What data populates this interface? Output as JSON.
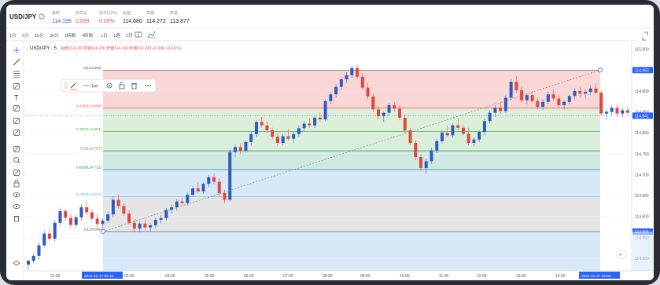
{
  "header": {
    "symbol": "USD/JPY",
    "stats": [
      {
        "label": "最新",
        "value": "114.199",
        "color": "#2962ff"
      },
      {
        "label": "前日比",
        "value": "0.099",
        "color": "#ef5350"
      },
      {
        "label": "前日比(%)",
        "value": "0.09%",
        "color": "#ef5350"
      },
      {
        "label": "始値",
        "value": "114.080",
        "color": "#222222"
      },
      {
        "label": "高値",
        "value": "114.272",
        "color": "#222222"
      },
      {
        "label": "安値",
        "value": "113.877",
        "color": "#222222"
      }
    ]
  },
  "timeframes": [
    "1分",
    "5分",
    "15分",
    "30分",
    "1時間",
    "4時間",
    "1日",
    "1週",
    "1月"
  ],
  "active_timeframe": "5分",
  "legend": {
    "pair": "USD/JPY · 5",
    "ohlc": "始値114.193 高値114.200 安値114.193 終値114.199 +0.006 (+0.01%)"
  },
  "drawing_toolbar": {
    "width_label": "1px"
  },
  "fib": {
    "levels": [
      {
        "ratio": "0",
        "label": "0(114.950)",
        "price": 114.95,
        "color": "#555555"
      },
      {
        "ratio": "0.236",
        "label": "0.236(114.859)",
        "price": 114.859,
        "color": "#ef5350"
      },
      {
        "ratio": "0.382",
        "label": "0.382(114.803)",
        "price": 114.803,
        "color": "#4caf50"
      },
      {
        "ratio": "0.5",
        "label": "0.5(114.757)",
        "price": 114.757,
        "color": "#2e9b3a"
      },
      {
        "ratio": "0.618",
        "label": "0.618(114.712)",
        "price": 114.712,
        "color": "#00897b"
      },
      {
        "ratio": "0.786",
        "label": "0.786(114.647)",
        "price": 114.647,
        "color": "#64b5f6"
      },
      {
        "ratio": "1",
        "label": "1(114.564)",
        "price": 114.564,
        "color": "#555555"
      }
    ]
  },
  "price_axis": {
    "ticks": [
      "115.000",
      "114.950",
      "114.900",
      "114.850",
      "114.800",
      "114.750",
      "114.700",
      "114.650",
      "114.600",
      "114.550",
      "114.500"
    ],
    "current_price": "114.841",
    "fib_top_tag": "114.950",
    "fib_bottom_tag": "114.564"
  },
  "time_axis": {
    "ticks": [
      "01:00",
      "02:15",
      "03:00",
      "04:00",
      "05:00",
      "06:00",
      "07:00",
      "08:00",
      "09:00",
      "10:00",
      "11:00",
      "12:00",
      "13:00",
      "14:00"
    ],
    "start_tag": "2021-11-17 02:15",
    "end_tag": "2021-11-17 15:00",
    "zoom": "1D"
  },
  "chart_data": {
    "type": "candlestick",
    "y_range": [
      114.47,
      115.02
    ],
    "candles": [
      [
        114.485,
        114.497,
        114.472,
        114.494
      ],
      [
        114.494,
        114.512,
        114.488,
        114.506
      ],
      [
        114.506,
        114.538,
        114.498,
        114.531
      ],
      [
        114.531,
        114.567,
        114.526,
        114.559
      ],
      [
        114.559,
        114.574,
        114.541,
        114.547
      ],
      [
        114.547,
        114.592,
        114.54,
        114.585
      ],
      [
        114.585,
        114.621,
        114.578,
        114.613
      ],
      [
        114.613,
        114.618,
        114.59,
        114.597
      ],
      [
        114.597,
        114.608,
        114.572,
        114.58
      ],
      [
        114.58,
        114.604,
        114.574,
        114.598
      ],
      [
        114.598,
        114.63,
        114.59,
        114.622
      ],
      [
        114.622,
        114.638,
        114.603,
        114.61
      ],
      [
        114.61,
        114.618,
        114.589,
        114.595
      ],
      [
        114.595,
        114.606,
        114.573,
        114.582
      ],
      [
        114.582,
        114.596,
        114.565,
        114.59
      ],
      [
        114.59,
        114.612,
        114.584,
        114.605
      ],
      [
        114.605,
        114.648,
        114.598,
        114.64
      ],
      [
        114.64,
        114.652,
        114.618,
        114.625
      ],
      [
        114.625,
        114.631,
        114.601,
        114.607
      ],
      [
        114.607,
        114.614,
        114.58,
        114.585
      ],
      [
        114.585,
        114.594,
        114.562,
        114.571
      ],
      [
        114.571,
        114.589,
        114.562,
        114.583
      ],
      [
        114.583,
        114.592,
        114.568,
        114.574
      ],
      [
        114.574,
        114.584,
        114.563,
        114.579
      ],
      [
        114.579,
        114.598,
        114.572,
        114.592
      ],
      [
        114.592,
        114.603,
        114.583,
        114.596
      ],
      [
        114.596,
        114.62,
        114.59,
        114.616
      ],
      [
        114.616,
        114.629,
        114.606,
        114.622
      ],
      [
        114.622,
        114.642,
        114.614,
        114.636
      ],
      [
        114.636,
        114.644,
        114.626,
        114.632
      ],
      [
        114.632,
        114.658,
        114.627,
        114.652
      ],
      [
        114.652,
        114.672,
        114.647,
        114.667
      ],
      [
        114.667,
        114.682,
        114.655,
        114.66
      ],
      [
        114.66,
        114.682,
        114.655,
        114.678
      ],
      [
        114.678,
        114.7,
        114.67,
        114.694
      ],
      [
        114.694,
        114.702,
        114.676,
        114.683
      ],
      [
        114.683,
        114.69,
        114.648,
        114.656
      ],
      [
        114.656,
        114.664,
        114.632,
        114.64
      ],
      [
        114.64,
        114.76,
        114.636,
        114.754
      ],
      [
        114.754,
        114.772,
        114.742,
        114.766
      ],
      [
        114.766,
        114.775,
        114.75,
        114.757
      ],
      [
        114.757,
        114.782,
        114.752,
        114.778
      ],
      [
        114.778,
        114.802,
        114.77,
        114.797
      ],
      [
        114.797,
        114.83,
        114.79,
        114.826
      ],
      [
        114.826,
        114.838,
        114.812,
        114.818
      ],
      [
        114.818,
        114.826,
        114.8,
        114.806
      ],
      [
        114.806,
        114.812,
        114.785,
        114.791
      ],
      [
        114.791,
        114.8,
        114.768,
        114.776
      ],
      [
        114.776,
        114.798,
        114.77,
        114.792
      ],
      [
        114.792,
        114.81,
        114.782,
        114.786
      ],
      [
        114.786,
        114.802,
        114.775,
        114.797
      ],
      [
        114.797,
        114.818,
        114.79,
        114.811
      ],
      [
        114.811,
        114.828,
        114.803,
        114.822
      ],
      [
        114.822,
        114.835,
        114.812,
        114.818
      ],
      [
        114.818,
        114.84,
        114.812,
        114.836
      ],
      [
        114.836,
        114.85,
        114.826,
        114.832
      ],
      [
        114.832,
        114.88,
        114.828,
        114.876
      ],
      [
        114.876,
        114.898,
        114.869,
        114.892
      ],
      [
        114.892,
        114.916,
        114.884,
        114.91
      ],
      [
        114.91,
        114.933,
        114.902,
        114.928
      ],
      [
        114.928,
        114.945,
        114.919,
        114.938
      ],
      [
        114.938,
        114.96,
        114.93,
        114.955
      ],
      [
        114.955,
        114.962,
        114.928,
        114.934
      ],
      [
        114.934,
        114.942,
        114.902,
        114.908
      ],
      [
        114.908,
        114.92,
        114.88,
        114.887
      ],
      [
        114.887,
        114.894,
        114.85,
        114.856
      ],
      [
        114.856,
        114.865,
        114.832,
        114.84
      ],
      [
        114.84,
        114.852,
        114.826,
        114.848
      ],
      [
        114.848,
        114.872,
        114.842,
        114.866
      ],
      [
        114.866,
        114.874,
        114.85,
        114.858
      ],
      [
        114.858,
        114.866,
        114.83,
        114.836
      ],
      [
        114.836,
        114.844,
        114.8,
        114.806
      ],
      [
        114.806,
        114.812,
        114.77,
        114.776
      ],
      [
        114.776,
        114.782,
        114.735,
        114.742
      ],
      [
        114.742,
        114.75,
        114.708,
        114.716
      ],
      [
        114.716,
        114.738,
        114.702,
        114.732
      ],
      [
        114.732,
        114.764,
        114.726,
        114.758
      ],
      [
        114.758,
        114.786,
        114.752,
        114.78
      ],
      [
        114.78,
        114.806,
        114.774,
        114.8
      ],
      [
        114.8,
        114.816,
        114.79,
        114.794
      ],
      [
        114.794,
        114.822,
        114.788,
        114.818
      ],
      [
        114.818,
        114.834,
        114.805,
        114.812
      ],
      [
        114.812,
        114.82,
        114.794,
        114.798
      ],
      [
        114.798,
        114.812,
        114.77,
        114.776
      ],
      [
        114.776,
        114.79,
        114.768,
        114.784
      ],
      [
        114.784,
        114.806,
        114.778,
        114.802
      ],
      [
        114.802,
        114.834,
        114.796,
        114.828
      ],
      [
        114.828,
        114.854,
        114.822,
        114.848
      ],
      [
        114.848,
        114.866,
        114.838,
        114.86
      ],
      [
        114.86,
        114.874,
        114.846,
        114.852
      ],
      [
        114.852,
        114.89,
        114.848,
        114.884
      ],
      [
        114.884,
        114.93,
        114.878,
        114.922
      ],
      [
        114.922,
        114.936,
        114.896,
        114.902
      ],
      [
        114.902,
        114.912,
        114.872,
        114.878
      ],
      [
        114.878,
        114.895,
        114.868,
        114.89
      ],
      [
        114.89,
        114.9,
        114.872,
        114.876
      ],
      [
        114.876,
        114.884,
        114.856,
        114.862
      ],
      [
        114.862,
        114.88,
        114.855,
        114.874
      ],
      [
        114.874,
        114.898,
        114.868,
        114.892
      ],
      [
        114.892,
        114.904,
        114.876,
        114.882
      ],
      [
        114.882,
        114.89,
        114.86,
        114.866
      ],
      [
        114.866,
        114.878,
        114.856,
        114.874
      ],
      [
        114.874,
        114.892,
        114.868,
        114.888
      ],
      [
        114.888,
        114.906,
        114.88,
        114.9
      ],
      [
        114.9,
        114.91,
        114.886,
        114.894
      ],
      [
        114.894,
        114.904,
        114.884,
        114.898
      ],
      [
        114.898,
        114.914,
        114.89,
        114.906
      ],
      [
        114.906,
        114.918,
        114.892,
        114.896
      ],
      [
        114.896,
        114.902,
        114.84,
        114.846
      ],
      [
        114.846,
        114.858,
        114.832,
        114.85
      ],
      [
        114.85,
        114.866,
        114.842,
        114.86
      ],
      [
        114.86,
        114.87,
        114.84,
        114.846
      ],
      [
        114.846,
        114.86,
        114.838,
        114.854
      ],
      [
        114.854,
        114.862,
        114.842,
        114.848
      ]
    ]
  }
}
